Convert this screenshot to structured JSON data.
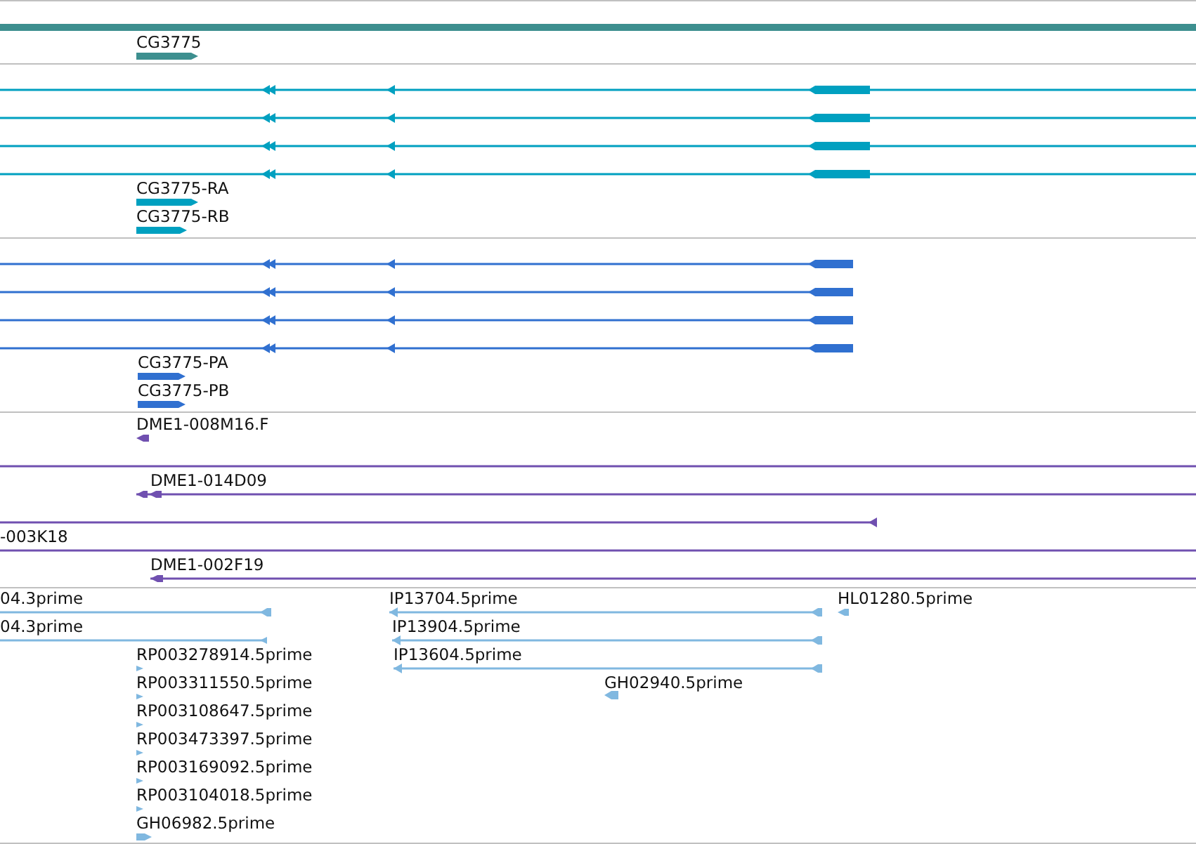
{
  "tracks": [
    {
      "kind": "gene",
      "color": "#3d8f8f",
      "features": [
        {
          "label": "CG3775"
        }
      ]
    },
    {
      "kind": "transcript",
      "color": "#00a0c0",
      "features": [
        {
          "label": "CG3775-RA"
        },
        {
          "label": "CG3775-RB"
        }
      ]
    },
    {
      "kind": "protein",
      "color": "#3070d0",
      "features": [
        {
          "label": "CG3775-PA"
        },
        {
          "label": "CG3775-PB"
        }
      ]
    },
    {
      "kind": "clone",
      "color": "#7050b0",
      "features": [
        {
          "label": "DME1-008M16.F"
        },
        {
          "label": "DME1-014D09"
        },
        {
          "label": "-003K18"
        },
        {
          "label": "DME1-002F19"
        }
      ]
    },
    {
      "kind": "est",
      "color": "#80b8e0",
      "features": [
        {
          "label": "04.3prime"
        },
        {
          "label": "IP13704.5prime"
        },
        {
          "label": "HL01280.5prime"
        },
        {
          "label": "04.3prime"
        },
        {
          "label": "IP13904.5prime"
        },
        {
          "label": "RP003278914.5prime"
        },
        {
          "label": "IP13604.5prime"
        },
        {
          "label": "RP003311550.5prime"
        },
        {
          "label": "GH02940.5prime"
        },
        {
          "label": "RP003108647.5prime"
        },
        {
          "label": "RP003473397.5prime"
        },
        {
          "label": "RP003169092.5prime"
        },
        {
          "label": "RP003104018.5prime"
        },
        {
          "label": "GH06982.5prime"
        }
      ]
    }
  ]
}
